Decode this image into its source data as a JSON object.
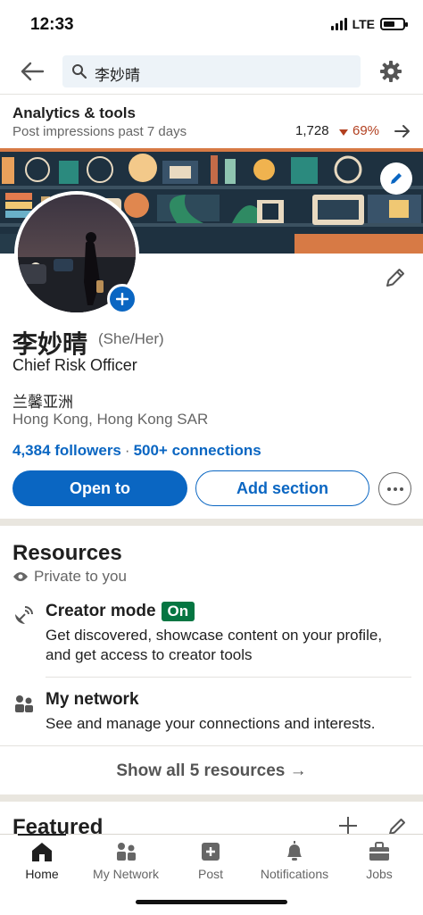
{
  "status_bar": {
    "time": "12:33",
    "network": "LTE"
  },
  "search": {
    "query": "李妙晴"
  },
  "analytics": {
    "title": "Analytics & tools",
    "subtitle": "Post impressions past 7 days",
    "impressions": "1,728",
    "change": "69%",
    "change_color": "#b24020"
  },
  "profile": {
    "name": "李妙晴",
    "pronouns": "(She/Her)",
    "headline": "Chief Risk Officer",
    "company": "兰馨亚洲",
    "location": "Hong Kong, Hong Kong SAR",
    "followers": "4,384 followers",
    "separator": "·",
    "connections": "500+ connections"
  },
  "actions": {
    "open_to": "Open to",
    "add_section": "Add section"
  },
  "resources": {
    "title": "Resources",
    "private_label": "Private to you",
    "items": [
      {
        "title": "Creator mode",
        "badge": "On",
        "description": "Get discovered, showcase content on your profile, and get access to creator tools",
        "icon": "satellite-dish-icon"
      },
      {
        "title": "My network",
        "description": "See and manage your connections and interests.",
        "icon": "people-icon"
      }
    ],
    "show_all": "Show all 5 resources →"
  },
  "featured": {
    "title": "Featured"
  },
  "bottom_nav": [
    {
      "label": "Home",
      "icon": "home-icon",
      "active": true
    },
    {
      "label": "My Network",
      "icon": "network-icon"
    },
    {
      "label": "Post",
      "icon": "post-icon"
    },
    {
      "label": "Notifications",
      "icon": "bell-icon"
    },
    {
      "label": "Jobs",
      "icon": "briefcase-icon"
    }
  ],
  "colors": {
    "brand_blue": "#0a66c2",
    "badge_green": "#057642",
    "section_gray": "#e9e6df"
  }
}
